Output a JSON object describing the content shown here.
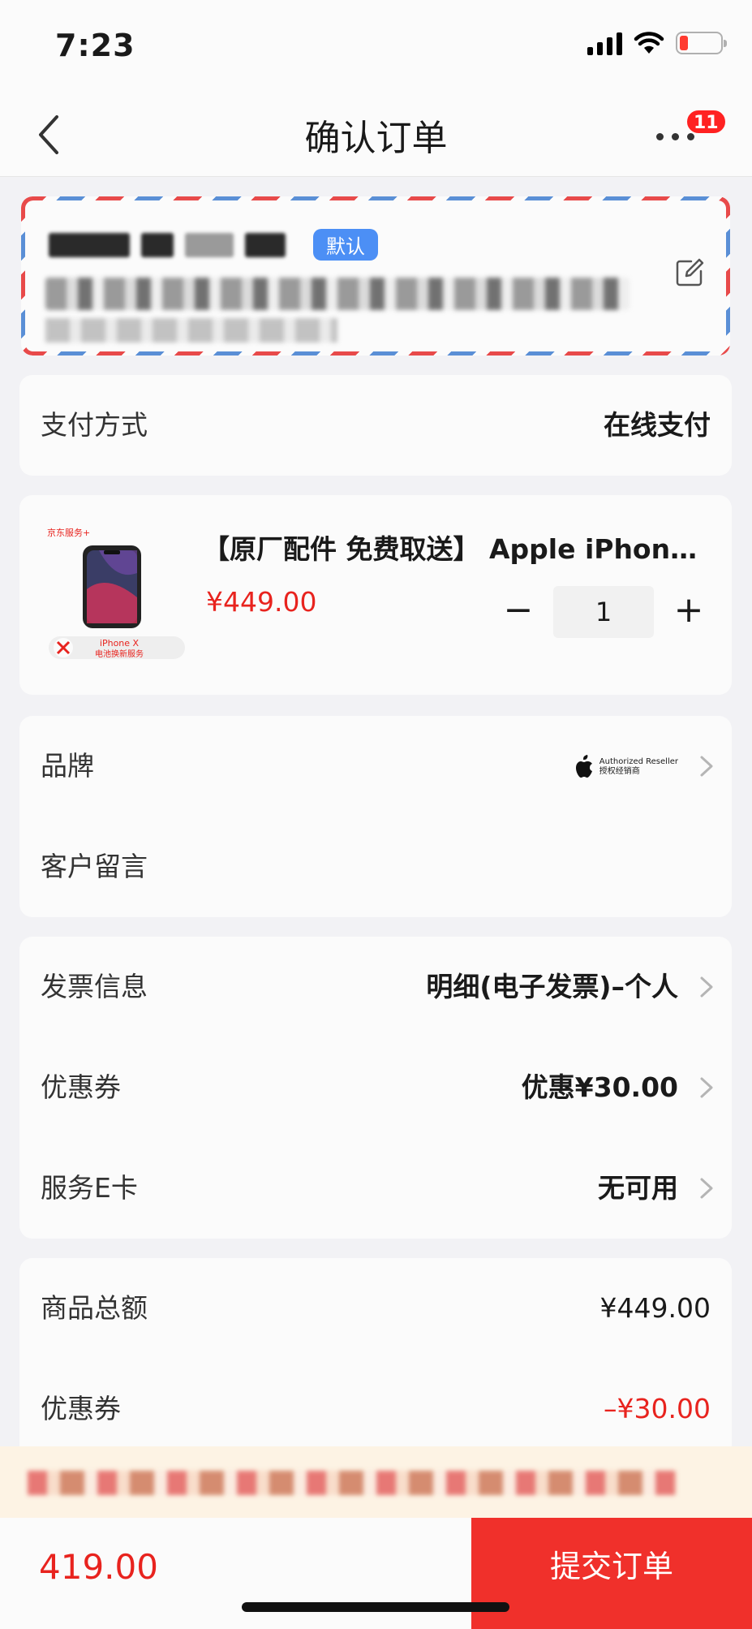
{
  "status_bar": {
    "time": "7:23"
  },
  "header": {
    "title": "确认订单",
    "badge_count": "11"
  },
  "address": {
    "default_tag": "默认"
  },
  "payment": {
    "label": "支付方式",
    "value": "在线支付"
  },
  "product": {
    "title": "【原厂配件 免费取送】 Apple iPhone X 电池换新服务",
    "price": "¥449.00",
    "quantity": "1",
    "minus": "−",
    "plus": "+"
  },
  "brand": {
    "label": "品牌",
    "badge_line1": "Authorized Reseller",
    "badge_line2": "授权经销商"
  },
  "message": {
    "label": "客户留言"
  },
  "invoice": {
    "label": "发票信息",
    "value": "明细(电子发票)–个人"
  },
  "coupon": {
    "label": "优惠券",
    "value": "优惠¥30.00"
  },
  "ecard": {
    "label": "服务E卡",
    "value": "无可用"
  },
  "summary": {
    "goods_total_label": "商品总额",
    "goods_total_value": "¥449.00",
    "coupon_label": "优惠券",
    "coupon_value": "–¥30.00"
  },
  "footer": {
    "total": "419.00",
    "submit_label": "提交订单"
  },
  "colors": {
    "accent_red": "#f0302b",
    "price_red": "#e8231e",
    "default_tag_blue": "#4c8ff5"
  }
}
